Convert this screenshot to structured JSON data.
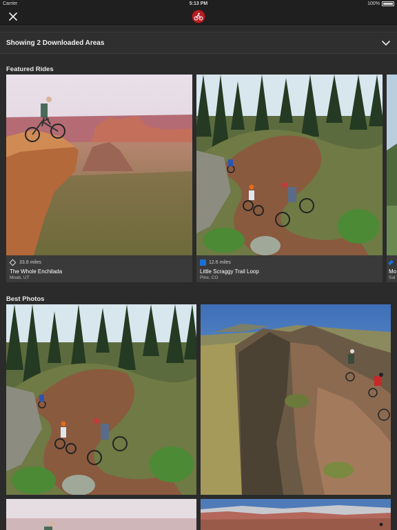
{
  "status_bar": {
    "carrier": "Carrier",
    "time": "5:13 PM",
    "battery": "100%"
  },
  "nav": {
    "close_icon": "close-icon",
    "logo_icon": "mtb-project-logo-icon"
  },
  "downloaded_areas": {
    "label": "Showing 2 Downloaded Areas",
    "icon": "chevron-down-icon"
  },
  "featured": {
    "title": "Featured Rides",
    "rides": [
      {
        "miles": "33.8 miles",
        "name": "The Whole Enchilada",
        "location": "Moab, UT",
        "difficulty_icon": "black-diamond-icon"
      },
      {
        "miles": "12.6 miles",
        "name": "Little Scraggy Trail Loop",
        "location": "Pine, CO",
        "difficulty_icon": "blue-square-icon",
        "difficulty_color": "#1c6fd6"
      },
      {
        "miles": "",
        "name": "Mo",
        "location": "Sal",
        "difficulty_icon": "blue-diamond-icon"
      }
    ]
  },
  "best_photos": {
    "title": "Best Photos"
  }
}
